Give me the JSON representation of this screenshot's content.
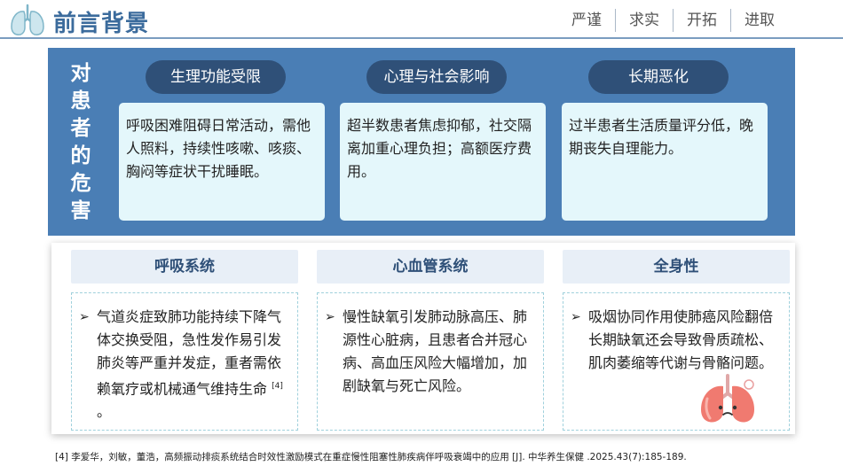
{
  "header": {
    "title": "前言背景",
    "nav": [
      "严谨",
      "求实",
      "开拓",
      "进取"
    ]
  },
  "harm": {
    "vertical_title": "对患者的危害",
    "columns": [
      {
        "label": "生理功能受限",
        "text": "呼吸困难阻碍日常活动，需他人照料，持续性咳嗽、咳痰、胸闷等症状干扰睡眠。"
      },
      {
        "label": "心理与社会影响",
        "text": "超半数患者焦虑抑郁，社交隔离加重心理负担；高额医疗费用。"
      },
      {
        "label": "长期恶化",
        "text": "过半患者生活质量评分低，晚期丧失自理能力。"
      }
    ]
  },
  "systems": [
    {
      "label": "呼吸系统",
      "bullet": "➢",
      "text": "气道炎症致肺功能持续下降气体交换受阻，急性发作易引发肺炎等严重并发症，重者需依赖氧疗或机械通气维持生命",
      "cite": "[4]",
      "end": "。"
    },
    {
      "label": "心血管系统",
      "bullet": "➢",
      "text": "慢性缺氧引发肺动脉高压、肺源性心脏病，且患者合并冠心病、高血压风险大幅增加，加剧缺氧与死亡风险。",
      "cite": "",
      "end": ""
    },
    {
      "label": "全身性",
      "bullet": "➢",
      "text": "吸烟协同作用使肺癌风险翻倍长期缺氧还会导致骨质疏松、肌肉萎缩等代谢与骨骼问题。",
      "cite": "",
      "end": ""
    }
  ],
  "footnote": "[4] 李爱华，刘敏，董浩，高频振动排痰系统结合时效性激励模式在重症慢性阻塞性肺疾病伴呼吸衰竭中的应用 [J]. 中华养生保健 .2025.43(7):185-189.",
  "icons": {
    "logo": "lungs-outline-icon",
    "illustration": "sad-lungs-icon"
  },
  "colors": {
    "title": "#3b6b9c",
    "panel": "#4a7eb5",
    "pill": "#2f5078",
    "box": "#e4f7fb",
    "category": "#e8eff7"
  }
}
